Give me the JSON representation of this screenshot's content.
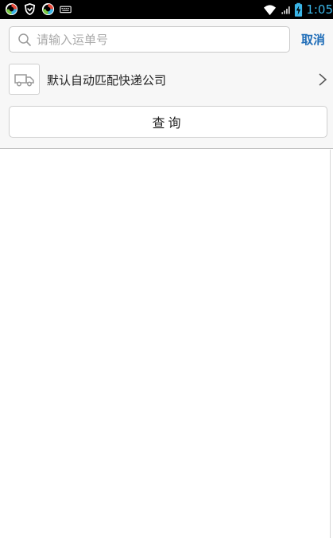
{
  "status_bar": {
    "time": "1:05",
    "left_icons": [
      "app-icon",
      "shield-icon",
      "app-icon",
      "keyboard-icon"
    ],
    "right_icons": [
      "wifi-icon",
      "signal-icon",
      "battery-icon"
    ]
  },
  "search": {
    "placeholder": "请输入运单号",
    "value": "",
    "cancel_label": "取消"
  },
  "company": {
    "icon": "truck-icon",
    "label": "默认自动匹配快递公司"
  },
  "query": {
    "button_label": "查询"
  },
  "colors": {
    "accent": "#1f6db8",
    "status_bar": "#000000",
    "clock": "#3bb6e8",
    "panel_bg": "#f7f7f7"
  }
}
